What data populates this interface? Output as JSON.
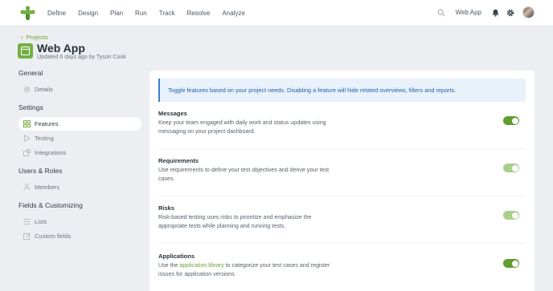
{
  "topbar": {
    "nav": [
      "Define",
      "Design",
      "Plan",
      "Run",
      "Track",
      "Resolve",
      "Analyze"
    ],
    "project_switch": "Web App"
  },
  "header": {
    "breadcrumb": "Projects",
    "title": "Web App",
    "subtitle": "Updated 6 days ago by Tyson Cook"
  },
  "sidebar": {
    "groups": [
      {
        "title": "General",
        "items": [
          {
            "label": "Details",
            "icon": "gear-icon"
          }
        ]
      },
      {
        "title": "Settings",
        "items": [
          {
            "label": "Features",
            "icon": "grid-icon",
            "active": true
          },
          {
            "label": "Testing",
            "icon": "play-icon"
          },
          {
            "label": "Integrations",
            "icon": "puzzle-icon"
          }
        ]
      },
      {
        "title": "Users & Roles",
        "items": [
          {
            "label": "Members",
            "icon": "user-icon"
          }
        ]
      },
      {
        "title": "Fields & Customizing",
        "items": [
          {
            "label": "Lists",
            "icon": "list-icon"
          },
          {
            "label": "Custom fields",
            "icon": "edit-icon"
          }
        ]
      }
    ]
  },
  "main": {
    "banner": "Toggle features based on your project needs. Disabling a feature will hide related overviews, filters and reports.",
    "features": [
      {
        "title": "Messages",
        "desc": "Keep your team engaged with daily work and status updates using messaging on your project dashboard.",
        "enabled": true,
        "locked": false
      },
      {
        "title": "Requirements",
        "desc": "Use requirements to define your test objectives and derive your test cases.",
        "enabled": true,
        "locked": true
      },
      {
        "title": "Risks",
        "desc": "Risk-based testing uses risks to prioritize and emphasize the appropriate tests while planning and running tests.",
        "enabled": true,
        "locked": true
      },
      {
        "title": "Applications",
        "desc_before": "Use the ",
        "desc_link": "application library",
        "desc_after": " to categorize your test cases and register issues for application versions.",
        "enabled": true,
        "locked": false
      }
    ]
  },
  "colors": {
    "accent": "#6aa535",
    "toggle_on": "#5e9e2f",
    "toggle_locked": "#a9cf8c",
    "banner_bg": "#e9f1fb",
    "banner_border": "#3a7fd0"
  }
}
